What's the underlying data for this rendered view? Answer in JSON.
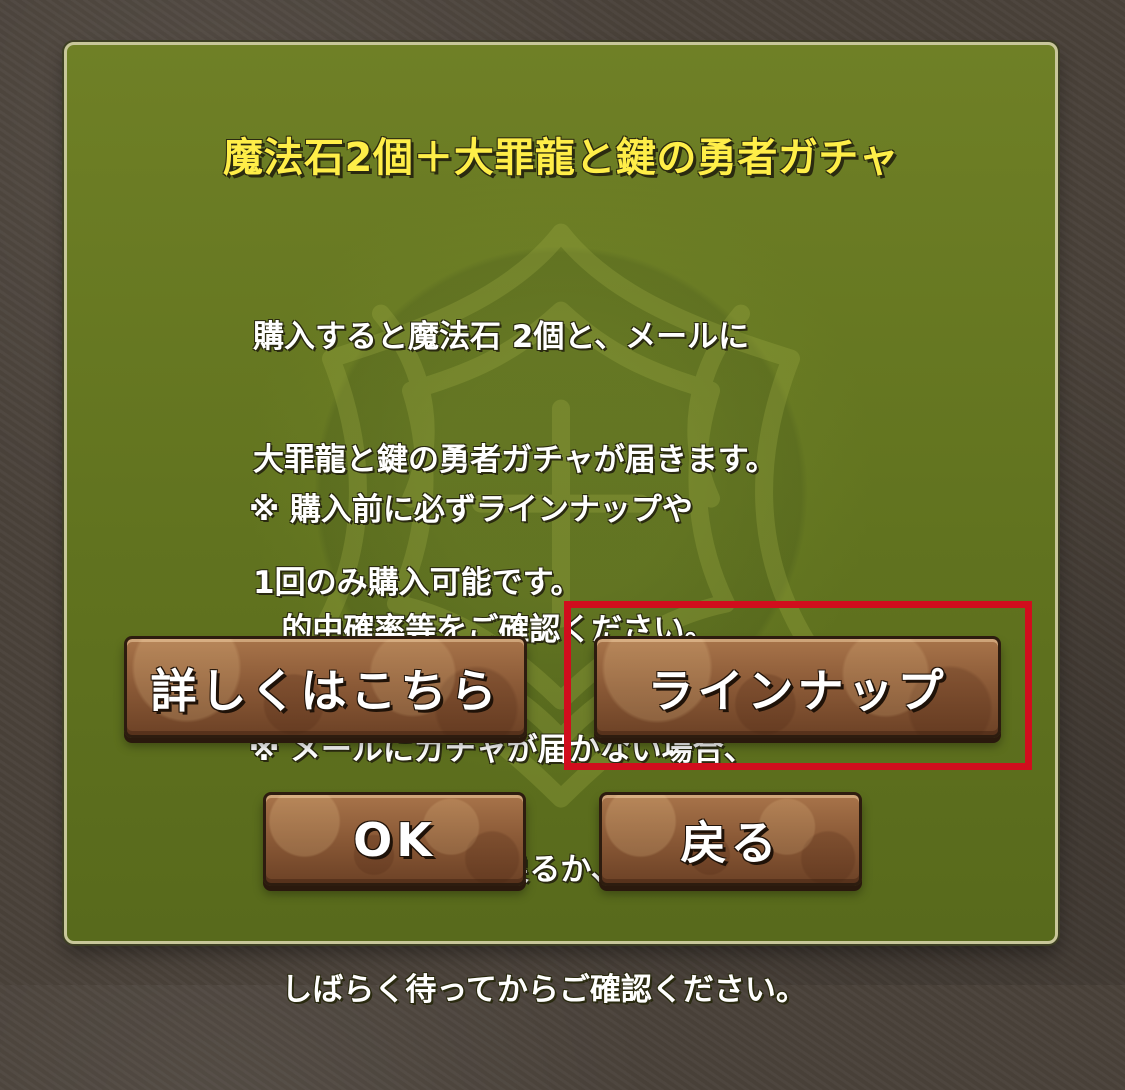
{
  "dialog": {
    "title": "魔法石2個＋大罪龍と鍵の勇者ガチャ",
    "message": {
      "line1": "購入すると魔法石 2個と、メールに",
      "line2": "大罪龍と鍵の勇者ガチャが届きます。",
      "line3": "1回のみ購入可能です。"
    },
    "notes": {
      "line1": "※ 購入前に必ずラインナップや",
      "line2": "   的中確率等をご確認ください。",
      "line3": "※ メールにガチャが届かない場合、",
      "line4": "   タイトル画面に戻るか、",
      "line5": "   しばらく待ってからご確認ください。"
    }
  },
  "buttons": {
    "details": "詳しくはこちら",
    "lineup": "ラインナップ",
    "ok": "OK",
    "back": "戻る"
  },
  "colors": {
    "dialog_bg": "#61731f",
    "title": "#ffee48",
    "button_brown": "#8b5a37",
    "highlight_red": "#d10d1d"
  },
  "icons": {
    "background_emblem": "decorative-emblem-icon"
  }
}
